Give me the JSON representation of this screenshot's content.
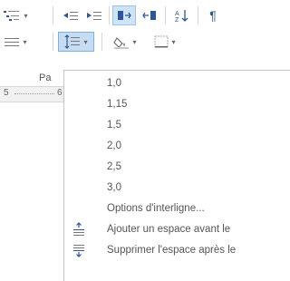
{
  "menu": {
    "spacing_options": [
      {
        "label": "1,0"
      },
      {
        "label": "1,15"
      },
      {
        "label": "1,5"
      },
      {
        "label": "2,0"
      },
      {
        "label": "2,5"
      },
      {
        "label": "3,0"
      }
    ],
    "line_spacing_options_label": "Options d'interligne...",
    "add_space_before_label": "Ajouter un espace avant le",
    "remove_space_after_label": "Supprimer l'espace après le"
  },
  "ribbon": {
    "group_label_partial": "Pa",
    "ruler": {
      "left_number": "5",
      "right_number": "6"
    }
  },
  "colors": {
    "accent": "#2b579a",
    "highlight": "#cfe3f7"
  }
}
